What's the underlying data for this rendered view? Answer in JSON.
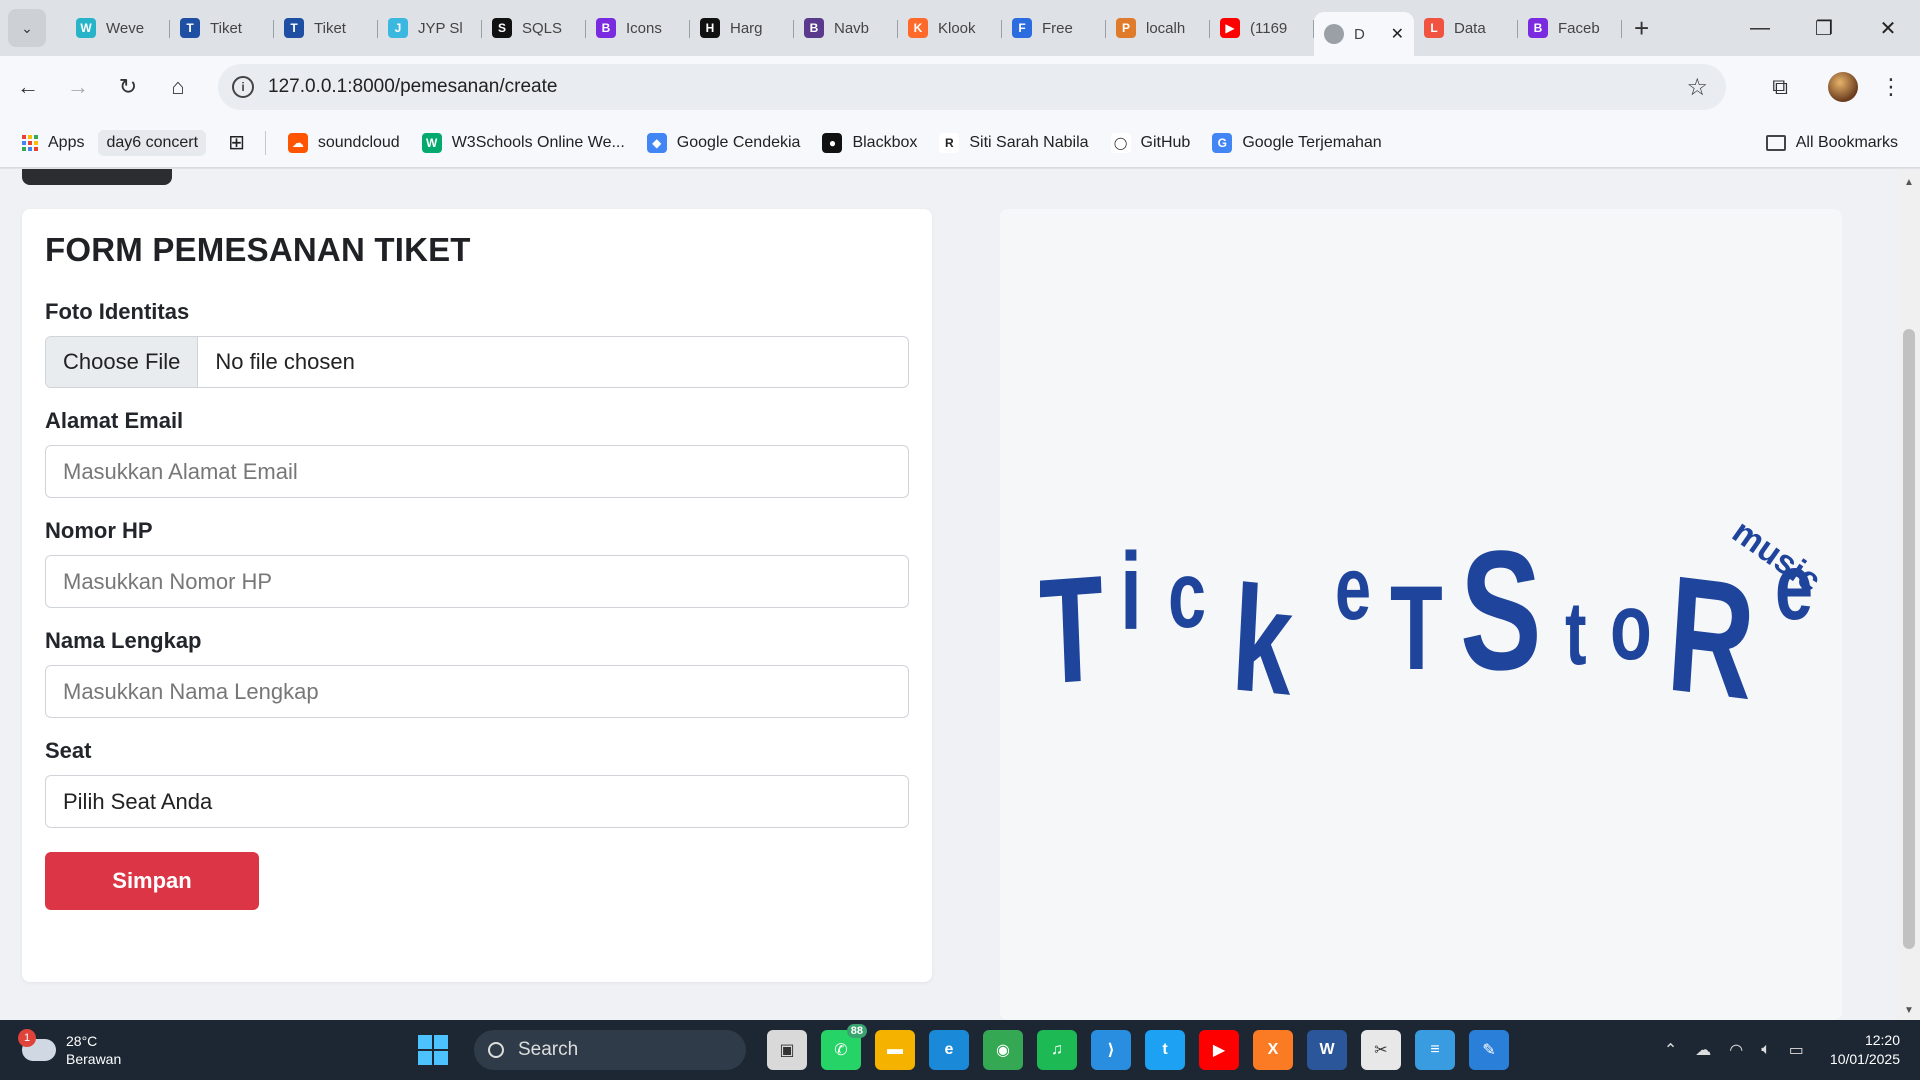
{
  "browser": {
    "tabs": [
      {
        "label": "Weve",
        "fav_color": "#28b4c8",
        "fav_glyph": "W"
      },
      {
        "label": "Tiket",
        "fav_color": "#1e4fa3",
        "fav_glyph": "T"
      },
      {
        "label": "Tiket",
        "fav_color": "#1e4fa3",
        "fav_glyph": "T"
      },
      {
        "label": "JYP Sl",
        "fav_color": "#3bb8e0",
        "fav_glyph": "J"
      },
      {
        "label": "SQLS",
        "fav_color": "#111111",
        "fav_glyph": "S"
      },
      {
        "label": "Icons",
        "fav_color": "#7a2be0",
        "fav_glyph": "B"
      },
      {
        "label": "Harg",
        "fav_color": "#111111",
        "fav_glyph": "H"
      },
      {
        "label": "Navb",
        "fav_color": "#5a3a8c",
        "fav_glyph": "B"
      },
      {
        "label": "Klook",
        "fav_color": "#ff6a2b",
        "fav_glyph": "K"
      },
      {
        "label": "Free",
        "fav_color": "#2b6de0",
        "fav_glyph": "F"
      },
      {
        "label": "localh",
        "fav_color": "#e07b2b",
        "fav_glyph": "P"
      },
      {
        "label": "(1169",
        "fav_color": "#ff0000",
        "fav_glyph": "▶"
      }
    ],
    "active_tab": {
      "label": "D",
      "close": "✕"
    },
    "tabs_after": [
      {
        "label": "Data",
        "fav_color": "#f05340",
        "fav_glyph": "L"
      },
      {
        "label": "Faceb",
        "fav_color": "#7a2be0",
        "fav_glyph": "B"
      }
    ],
    "new_tab": "+",
    "window_controls": {
      "minimize": "—",
      "restore": "❐",
      "close": "✕"
    },
    "url": "127.0.0.1:8000/pemesanan/create",
    "nav": {
      "back": "←",
      "forward": "→",
      "reload": "↻",
      "home": "⌂"
    },
    "star": "☆",
    "menu": "⋮",
    "extensions": "⧉",
    "info": "i"
  },
  "bookmarks": {
    "apps": "Apps",
    "day6": "day6 concert",
    "items": [
      {
        "label": "soundcloud",
        "color": "#ff5500",
        "glyph": "☁"
      },
      {
        "label": "W3Schools Online We...",
        "color": "#04aa6d",
        "glyph": "W"
      },
      {
        "label": "Google Cendekia",
        "color": "#4285f4",
        "glyph": "◆"
      },
      {
        "label": "Blackbox",
        "color": "#111111",
        "glyph": "●"
      },
      {
        "label": "Siti Sarah Nabila",
        "color": "#ffffff",
        "glyph": "R"
      },
      {
        "label": "GitHub",
        "color": "#ffffff",
        "glyph": "◯"
      },
      {
        "label": "Google Terjemahan",
        "color": "#4285f4",
        "glyph": "G"
      }
    ],
    "all": "All Bookmarks"
  },
  "form": {
    "title": "FORM PEMESANAN TIKET",
    "foto": {
      "label": "Foto Identitas",
      "button": "Choose File",
      "status": "No file chosen"
    },
    "email": {
      "label": "Alamat Email",
      "placeholder": "Masukkan Alamat Email"
    },
    "hp": {
      "label": "Nomor HP",
      "placeholder": "Masukkan Nomor HP"
    },
    "nama": {
      "label": "Nama Lengkap",
      "placeholder": "Masukkan Nama Lengkap"
    },
    "seat": {
      "label": "Seat",
      "selected": "Pilih Seat Anda"
    },
    "submit": "Simpan",
    "submit_color": "#dc3545"
  },
  "logo": {
    "letters": [
      "T",
      "i",
      "c",
      "k",
      "e",
      "T",
      "S",
      "t",
      "o",
      "R",
      "e"
    ],
    "tag": "music",
    "color": "#1f449b"
  },
  "taskbar": {
    "weather": {
      "temp": "28°C",
      "desc": "Berawan",
      "badge": "1"
    },
    "search": "Search",
    "whatsapp_count": "88",
    "apps": [
      {
        "name": "file-explorer-icon",
        "color": "#f5b300",
        "glyph": "▬"
      },
      {
        "name": "edge-icon",
        "color": "#1a8ad8",
        "glyph": "e"
      },
      {
        "name": "chrome-icon",
        "color": "#34a853",
        "glyph": "◉"
      },
      {
        "name": "spotify-icon",
        "color": "#1db954",
        "glyph": "♫"
      },
      {
        "name": "vscode-icon",
        "color": "#2a8ee0",
        "glyph": "⟩"
      },
      {
        "name": "twitter-icon",
        "color": "#1da1f2",
        "glyph": "t"
      },
      {
        "name": "youtube-icon",
        "color": "#ff0000",
        "glyph": "▶"
      },
      {
        "name": "xampp-icon",
        "color": "#fb7a24",
        "glyph": "X"
      },
      {
        "name": "word-icon",
        "color": "#2b579a",
        "glyph": "W"
      },
      {
        "name": "snipping-icon",
        "color": "#e8e8e8",
        "glyph": "✂"
      },
      {
        "name": "notepad-icon",
        "color": "#3a9ce0",
        "glyph": "≡"
      },
      {
        "name": "paint-icon",
        "color": "#2a7fd8",
        "glyph": "✎"
      }
    ],
    "time": "12:20",
    "date": "10/01/2025"
  }
}
